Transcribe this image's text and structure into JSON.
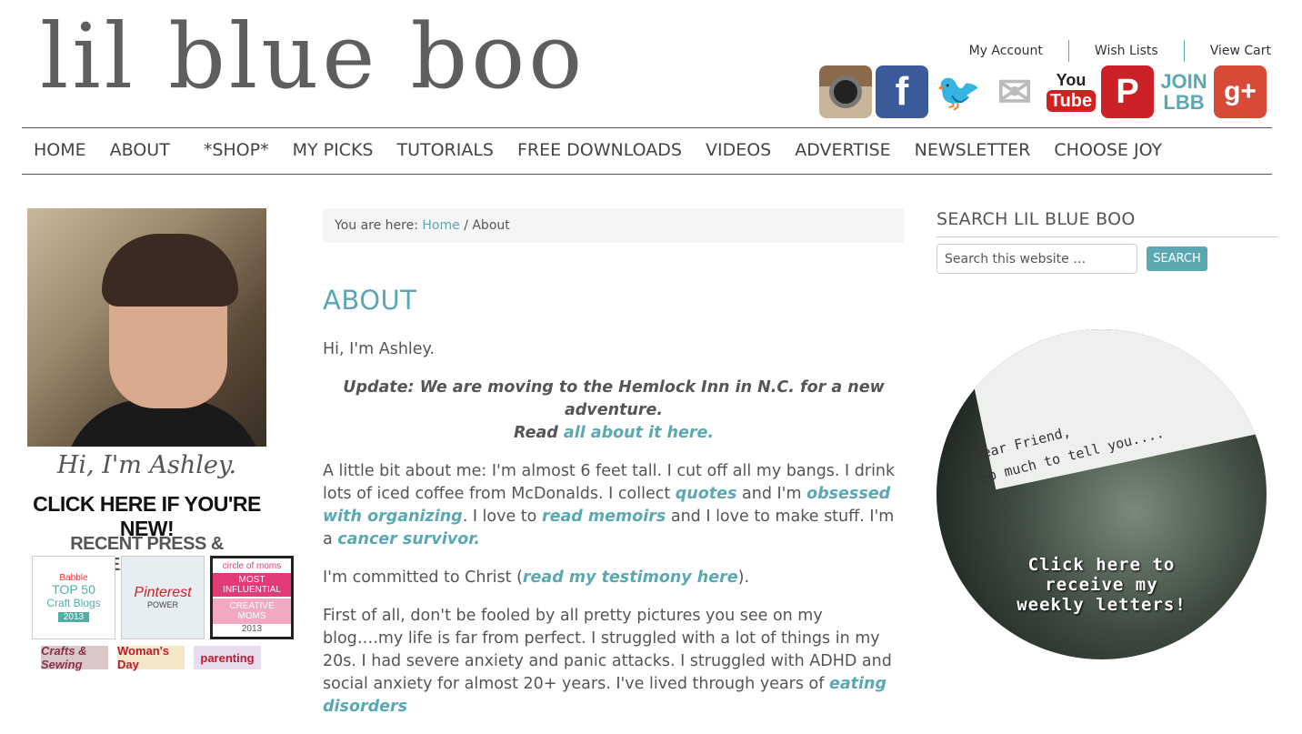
{
  "header": {
    "logo_text": "lil blue boo",
    "top_links": [
      "My Account",
      "Wish Lists",
      "View Cart"
    ],
    "social": {
      "instagram": "",
      "facebook": "f",
      "twitter": "🐦",
      "email": "✉",
      "youtube_top": "You",
      "youtube_bottom": "Tube",
      "pinterest": "P",
      "join_top": "JOIN",
      "join_bottom": "LBB",
      "googleplus": "g+"
    }
  },
  "nav": [
    "HOME",
    "ABOUT",
    "*SHOP*",
    "MY PICKS",
    "TUTORIALS",
    "FREE DOWNLOADS",
    "VIDEOS",
    "ADVERTISE",
    "NEWSLETTER",
    "CHOOSE JOY"
  ],
  "left": {
    "greeting": "Hi, I'm Ashley.",
    "new_cta": "CLICK HERE IF YOU'RE NEW!",
    "press_heading": "RECENT PRESS & FEATURES:",
    "badges": [
      {
        "top": "Babble",
        "main": "TOP 50",
        "sub": "Craft Blogs",
        "year": "2013"
      },
      {
        "main": "Pinterest",
        "sub": "POWER"
      },
      {
        "top": "circle of moms",
        "bar": "MOST INFLUENTIAL",
        "pink": "CREATIVE MOMS",
        "year": "2013"
      }
    ],
    "magazines": [
      "Crafts & Sewing",
      "Woman's Day",
      "parenting"
    ]
  },
  "main": {
    "breadcrumb_prefix": "You are here:",
    "breadcrumb_home": "Home",
    "breadcrumb_sep": "/",
    "breadcrumb_current": "About",
    "title": "ABOUT",
    "intro": "Hi, I'm Ashley.",
    "update_text": "Update: We are moving to the Hemlock Inn in N.C. for a new adventure.",
    "update_read": "Read",
    "update_link": "all about it here.",
    "p1_a": "A little bit about me:  I'm almost 6 feet tall.  I cut off all my bangs. I drink lots of iced coffee from McDonalds. I collect ",
    "p1_link1": "quotes",
    "p1_b": " and I'm ",
    "p1_link2": "obsessed with organizing",
    "p1_c": ". I love to ",
    "p1_link3": "read memoirs",
    "p1_d": " and I love to make stuff. I'm a ",
    "p1_link4": "cancer survivor.",
    "p2_a": "I'm committed to Christ (",
    "p2_link": "read my testimony here",
    "p2_b": ").",
    "p3_a": "First of all, don't be fooled by all pretty pictures you see on my blog….my life is far from perfect. I struggled with a lot of things in my 20s. I had severe anxiety and panic attacks. I struggled with ADHD and social anxiety for almost 20+ years. I've lived through years of ",
    "p3_link": "eating disorders"
  },
  "sidebar": {
    "search_heading": "SEARCH LIL BLUE BOO",
    "search_placeholder": "Search this website …",
    "search_button": "SEARCH",
    "newsletter_typed_1": "Dear Friend,",
    "newsletter_typed_2": "So much to tell you....",
    "newsletter_cta_1": "Click here to",
    "newsletter_cta_2": "receive my",
    "newsletter_cta_3": "weekly letters!"
  },
  "colors": {
    "accent": "#5aa8b2",
    "text": "#555555",
    "rule": "#555555"
  }
}
